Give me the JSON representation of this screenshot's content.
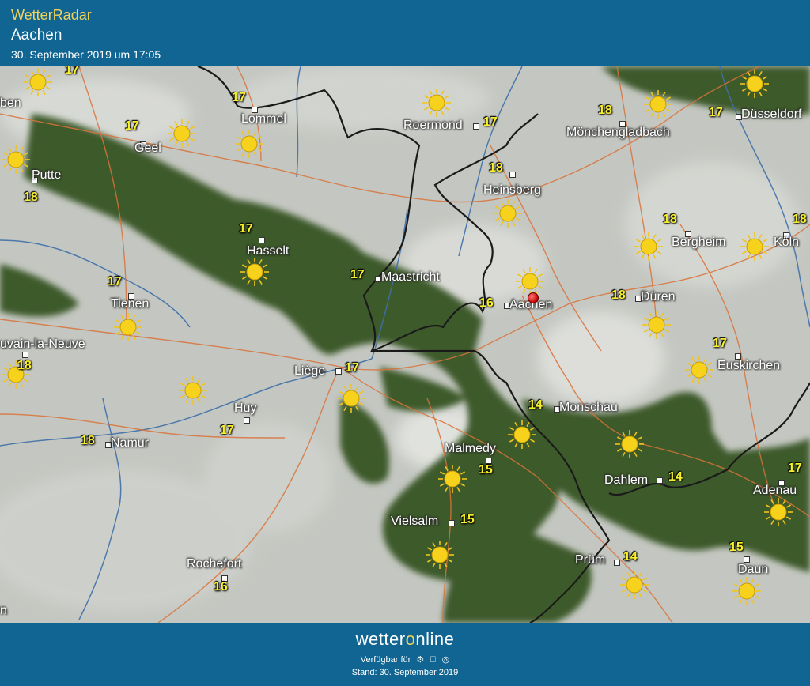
{
  "header": {
    "app_title": "WetterRadar",
    "city": "Aachen",
    "timestamp": "30. September 2019 um 17:05"
  },
  "footer": {
    "brand_prefix": "wetter",
    "brand_o": "o",
    "brand_suffix": "nline",
    "available_label": "Verfügbar für",
    "platform_icons": [
      "android-icon",
      "apple-icon",
      "web-icon"
    ],
    "stand": "Stand: 30. September 2019"
  },
  "colors": {
    "header_bg": "#106592",
    "title_yellow": "#f1d25c",
    "forest_green": "#3c5a2a",
    "cloud_gray": "#c4c7c1",
    "temperature": "#f7f02a",
    "border_line": "#1a1a1a",
    "road": "#d9733a",
    "river": "#3f6fa8"
  },
  "places": [
    {
      "id": "lommel",
      "name": "Lommel",
      "temp": "17"
    },
    {
      "id": "geel",
      "name": "Geel",
      "temp": "17"
    },
    {
      "id": "putte",
      "name": "Putte",
      "temp": "18"
    },
    {
      "id": "hasselt",
      "name": "Hasselt",
      "temp": "17"
    },
    {
      "id": "tienen",
      "name": "Tienen",
      "temp": "17"
    },
    {
      "id": "louvain",
      "name": "uvain-la-Neuve",
      "temp": "18"
    },
    {
      "id": "liege",
      "name": "Liège",
      "temp": "17"
    },
    {
      "id": "huy",
      "name": "Huy",
      "temp": "17"
    },
    {
      "id": "namur",
      "name": "Namur",
      "temp": "18"
    },
    {
      "id": "rochefort",
      "name": "Rochefort",
      "temp": "16"
    },
    {
      "id": "maastricht",
      "name": "Maastricht",
      "temp": "17"
    },
    {
      "id": "roermond",
      "name": "Roermond",
      "temp": "17"
    },
    {
      "id": "heinsberg",
      "name": "Heinsberg",
      "temp": "18"
    },
    {
      "id": "monchengladbach",
      "name": "Mönchengladbach",
      "temp": "18"
    },
    {
      "id": "dusseldorf",
      "name": "Düsseldorf",
      "temp": "17"
    },
    {
      "id": "aachen",
      "name": "Aachen",
      "temp": "16"
    },
    {
      "id": "duren",
      "name": "Düren",
      "temp": "18"
    },
    {
      "id": "bergheim",
      "name": "Bergheim",
      "temp": "18"
    },
    {
      "id": "koln",
      "name": "Köln",
      "temp": "18"
    },
    {
      "id": "euskirchen",
      "name": "Euskirchen",
      "temp": "17"
    },
    {
      "id": "monschau",
      "name": "Monschau",
      "temp": "14"
    },
    {
      "id": "malmedy",
      "name": "Malmedy",
      "temp": "15"
    },
    {
      "id": "vielsalm",
      "name": "Vielsalm",
      "temp": "15"
    },
    {
      "id": "dahlem",
      "name": "Dahlem",
      "temp": "14"
    },
    {
      "id": "adenau",
      "name": "Adenau",
      "temp": "17"
    },
    {
      "id": "prum",
      "name": "Prüm",
      "temp": "14"
    },
    {
      "id": "daun",
      "name": "Daun",
      "temp": "15"
    }
  ],
  "edge_labels": {
    "left_top": "ben",
    "left_bottom": "n",
    "top_temp": "17"
  }
}
